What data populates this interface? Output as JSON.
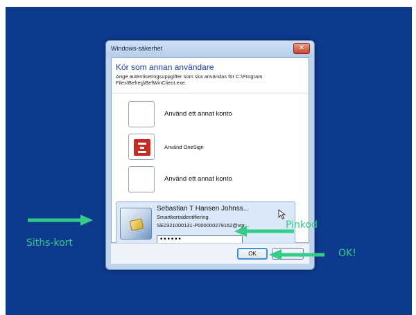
{
  "window": {
    "title": "Windows-säkerhet",
    "close_glyph": "✕"
  },
  "dialog": {
    "heading": "Kör som annan användare",
    "description": "Ange autentiseringsuppgifter som ska användas för C:\\Program Files\\Befreg\\BefWinClient.exe."
  },
  "options": [
    {
      "label": "Använd ett annat konto",
      "icon": "blank-account-icon"
    },
    {
      "label": "Använd OneSign",
      "icon": "onesign-logo-icon"
    },
    {
      "label": "Använd ett annat konto",
      "icon": "blank-account-icon"
    }
  ],
  "smartcard": {
    "user_name": "Sebastian T Hansen Johnss...",
    "card_type": "Smartkortsidentifiering",
    "card_id": "SE2321000131-P000000279162@vgr...",
    "pin_value": "••••••",
    "icon": "smartcard-icon"
  },
  "buttons": {
    "ok": "OK",
    "cancel": ""
  },
  "annotations": {
    "siths": "Siths-kort",
    "pinkod": "Pinkod",
    "ok": "OK!",
    "color": "#33cc88"
  },
  "colors": {
    "desktop_bg": "#0e3a8d",
    "heading": "#1a3a9c",
    "close_button": "#c8442b"
  }
}
